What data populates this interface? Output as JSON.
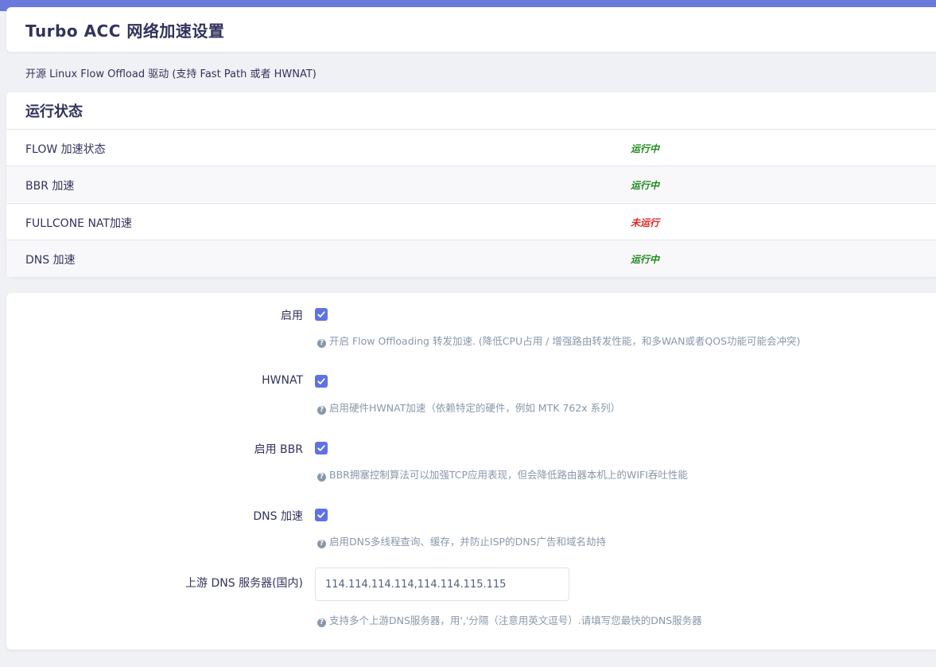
{
  "page": {
    "title": "Turbo ACC 网络加速设置",
    "description": "开源 Linux Flow Offload 驱动 (支持 Fast Path 或者 HWNAT)"
  },
  "status": {
    "heading": "运行状态",
    "rows": [
      {
        "name": "FLOW 加速状态",
        "value": "运行中"
      },
      {
        "name": "BBR 加速",
        "value": "运行中"
      },
      {
        "name": "FULLCONE NAT加速",
        "value": "未运行"
      },
      {
        "name": "DNS 加速",
        "value": "运行中"
      }
    ]
  },
  "colors": {
    "accent": "#5e72e4",
    "running": "#1e8a1e",
    "stopped": "#e02424"
  },
  "form": {
    "enable": {
      "label": "启用",
      "checked": true,
      "help": "开启 Flow Offloading 转发加速. (降低CPU占用 / 增强路由转发性能，和多WAN或者QOS功能可能会冲突)"
    },
    "hwnat": {
      "label": "HWNAT",
      "checked": true,
      "help": "启用硬件HWNAT加速（依赖特定的硬件，例如 MTK 762x 系列）"
    },
    "bbr": {
      "label": "启用 BBR",
      "checked": true,
      "help": "BBR拥塞控制算法可以加强TCP应用表现，但会降低路由器本机上的WIFI吞吐性能"
    },
    "dns": {
      "label": "DNS 加速",
      "checked": true,
      "help": "启用DNS多线程查询、缓存，并防止ISP的DNS广告和域名劫持"
    },
    "upstream_dns": {
      "label": "上游 DNS 服务器(国内)",
      "value": "114.114.114.114,114.114.115.115",
      "help": "支持多个上游DNS服务器，用','分隔（注意用英文逗号）.请填写您最快的DNS服务器"
    }
  }
}
